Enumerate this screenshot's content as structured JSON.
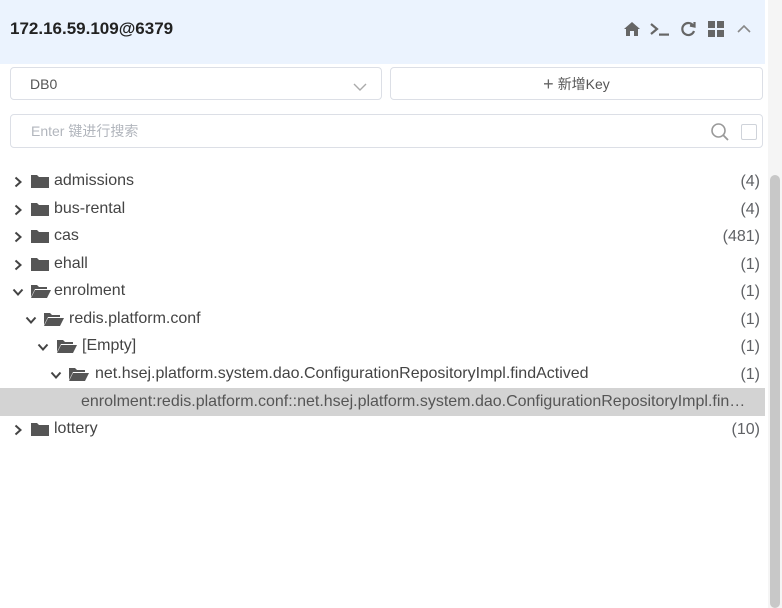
{
  "header": {
    "connection": "172.16.59.109@6379",
    "icons": [
      "home-icon",
      "terminal-icon",
      "refresh-icon",
      "grid-icon",
      "chevron-up-icon"
    ]
  },
  "db_select": {
    "value": "DB0"
  },
  "add_key": {
    "label": "新增Key"
  },
  "search": {
    "placeholder": "Enter 键进行搜索",
    "value": ""
  },
  "tree": [
    {
      "label": "admissions",
      "count": "(4)",
      "expanded": false,
      "depth": 0,
      "type": "folder"
    },
    {
      "label": "bus-rental",
      "count": "(4)",
      "expanded": false,
      "depth": 0,
      "type": "folder"
    },
    {
      "label": "cas",
      "count": "(481)",
      "expanded": false,
      "depth": 0,
      "type": "folder"
    },
    {
      "label": "ehall",
      "count": "(1)",
      "expanded": false,
      "depth": 0,
      "type": "folder"
    },
    {
      "label": "enrolment",
      "count": "(1)",
      "expanded": true,
      "depth": 0,
      "type": "folder"
    },
    {
      "label": "redis.platform.conf",
      "count": "(1)",
      "expanded": true,
      "depth": 1,
      "type": "folder"
    },
    {
      "label": "[Empty]",
      "count": "(1)",
      "expanded": true,
      "depth": 2,
      "type": "folder"
    },
    {
      "label": "net.hsej.platform.system.dao.ConfigurationRepositoryImpl.findActived",
      "count": "(1)",
      "expanded": true,
      "depth": 3,
      "type": "folder"
    },
    {
      "label": "enrolment:redis.platform.conf::net.hsej.platform.system.dao.ConfigurationRepositoryImpl.findActived",
      "count": "",
      "expanded": false,
      "depth": 4,
      "type": "key",
      "selected": true
    },
    {
      "label": "lottery",
      "count": "(10)",
      "expanded": false,
      "depth": 0,
      "type": "folder"
    }
  ],
  "colors": {
    "header_bg": "#ebf3fe",
    "selected_row": "#d3d3d3",
    "icon": "#666666"
  }
}
